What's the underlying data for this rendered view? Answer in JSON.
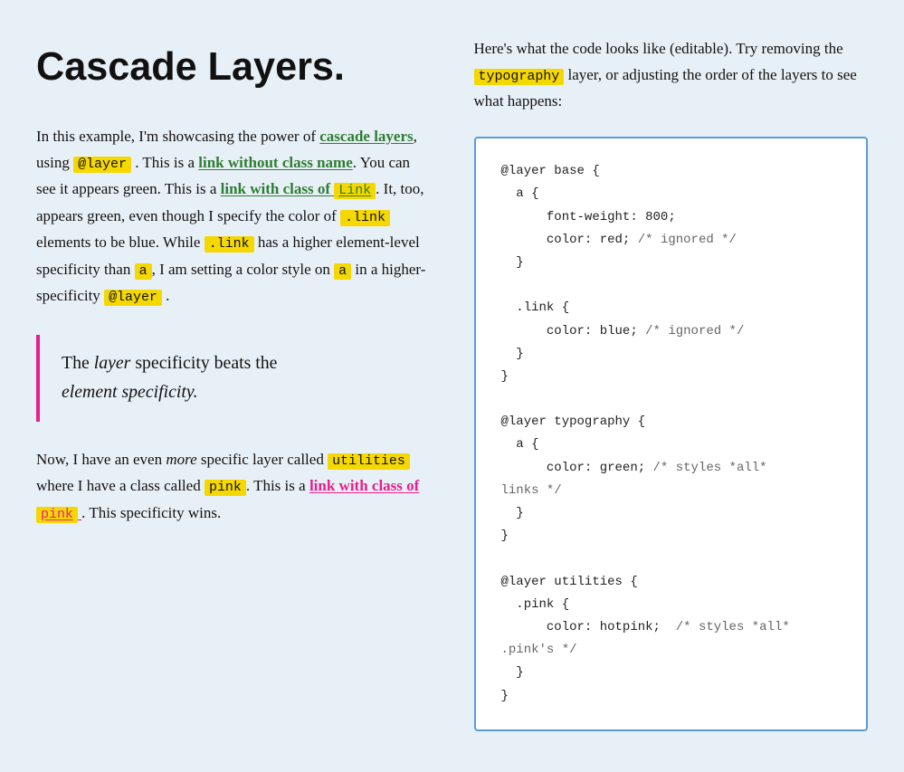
{
  "page": {
    "title": "Cascade Layers.",
    "left_column": {
      "intro": "In this example, I'm showcasing the power of",
      "cascade_layers_link_text": "cascade layers",
      "mid1": ", using",
      "at_layer_badge": "@layer",
      "mid2": ". This is a",
      "link_without_class": "link without class name",
      "mid3": ". You can see it appears green. This is a",
      "link_with_class_prefix": "link with class of",
      "link_badge": "Link",
      "mid4": ". It, too, appears green, even though I specify the color of",
      "dot_link_badge1": ".link",
      "mid5": "elements to be blue. While",
      "dot_link_badge2": ".link",
      "mid6": "has a higher element-level specificity than",
      "a_badge1": "a",
      "mid7": ", I am setting a color style on",
      "a_badge2": "a",
      "mid8": "in a higher-specificity",
      "at_layer_badge2": "@layer",
      "mid9": ".",
      "blockquote_line1": "The",
      "blockquote_em1": "layer",
      "blockquote_line2": "specificity beats the",
      "blockquote_line3": "element specificity",
      "blockquote_period": ".",
      "bottom_intro": "Now, I have an even",
      "bottom_more": "more",
      "bottom_text1": "specific layer called",
      "utilities_badge": "utilities",
      "bottom_text2": "where I have a class called",
      "pink_badge": "pink",
      "bottom_text3": ". This is a",
      "link_with_class_of": "link with class of",
      "pink_link_badge": "pink",
      "bottom_text4": ". This specificity wins."
    },
    "right_column": {
      "intro1": "Here's what the code looks like (editable). Try removing the",
      "typography_badge": "typography",
      "intro2": "layer, or adjusting the order of the layers to see what happens:",
      "code": "@layer base {\n  a {\n      font-weight: 800;\n      color: red; /* ignored */\n  }\n\n  .link {\n      color: blue; /* ignored */\n  }\n}\n\n@layer typography {\n  a {\n      color: green; /* styles *all*\nlinks */\n  }\n}\n\n@layer utilities {\n  .pink {\n      color: hotpink;  /* styles *all*\n.pink's */\n  }\n}"
    }
  }
}
